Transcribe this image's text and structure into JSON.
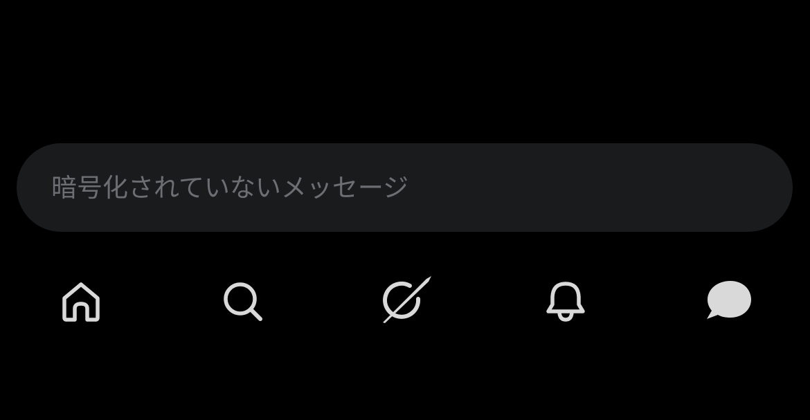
{
  "composer": {
    "placeholder": "暗号化されていないメッセージ",
    "value": ""
  },
  "tabs": [
    {
      "name": "home",
      "icon": "home-icon"
    },
    {
      "name": "search",
      "icon": "search-icon"
    },
    {
      "name": "grok",
      "icon": "grok-icon"
    },
    {
      "name": "notifications",
      "icon": "bell-icon"
    },
    {
      "name": "messages",
      "icon": "message-bubble-icon",
      "active": true
    }
  ],
  "colors": {
    "background": "#000000",
    "composer_bg": "#1a1b1d",
    "placeholder": "#6d6e72",
    "icon": "#d9d9d9"
  }
}
